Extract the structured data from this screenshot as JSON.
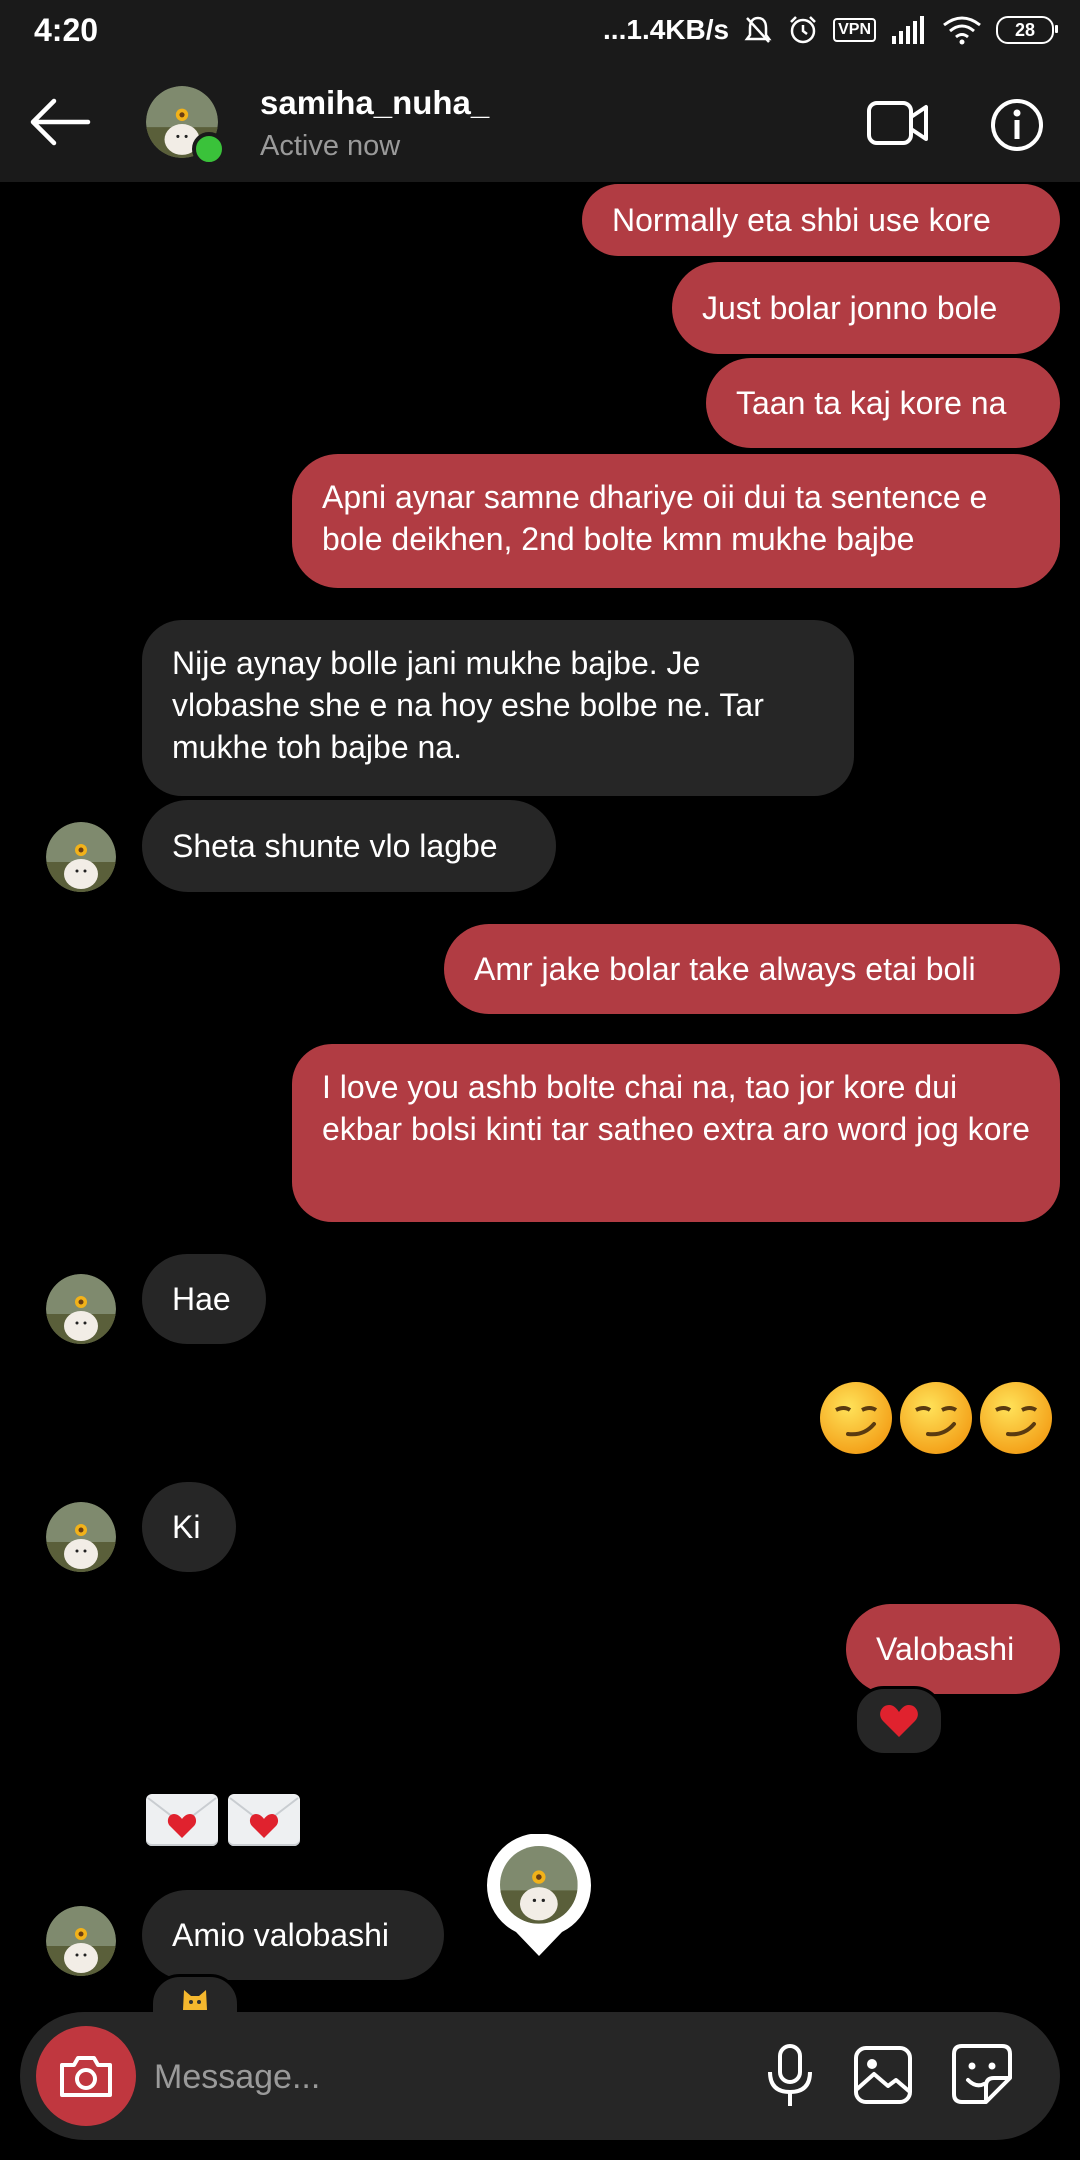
{
  "status_bar": {
    "time": "4:20",
    "network_speed": "...1.4KB/s",
    "vpn": "VPN",
    "battery": "28"
  },
  "header": {
    "username": "samiha_nuha_",
    "status": "Active now"
  },
  "messages": [
    {
      "side": "sent",
      "text": "Normally eta shbi use kore"
    },
    {
      "side": "sent",
      "text": "Just bolar jonno bole"
    },
    {
      "side": "sent",
      "text": "Taan ta kaj kore na"
    },
    {
      "side": "sent",
      "text": "Apni aynar samne dhariye oii dui ta sentence e bole deikhen, 2nd bolte kmn mukhe bajbe"
    },
    {
      "side": "received",
      "text": "Nije aynay bolle jani mukhe bajbe. Je vlobashe she e na hoy eshe bolbe ne. Tar mukhe toh bajbe na."
    },
    {
      "side": "received",
      "text": "Sheta shunte vlo lagbe"
    },
    {
      "side": "sent",
      "text": "Amr jake bolar take always etai boli"
    },
    {
      "side": "sent",
      "text": "I love you ashb bolte chai na, tao jor kore dui ekbar bolsi kinti tar satheo extra aro word jog kore"
    },
    {
      "side": "received",
      "text": "Hae"
    },
    {
      "side": "sent",
      "emoji": "smirking-face ×3"
    },
    {
      "side": "received",
      "text": "Ki"
    },
    {
      "side": "sent",
      "text": "Valobashi",
      "reaction": "red-heart"
    },
    {
      "side": "received",
      "emoji": "love-letter ×2"
    },
    {
      "side": "received",
      "text": "Amio valobashi",
      "reaction": "cat"
    }
  ],
  "composer": {
    "placeholder": "Message..."
  },
  "colors": {
    "sent_bubble": "#b13c43",
    "received_bubble": "#262626",
    "background": "#000000",
    "online": "#3ac23a"
  }
}
